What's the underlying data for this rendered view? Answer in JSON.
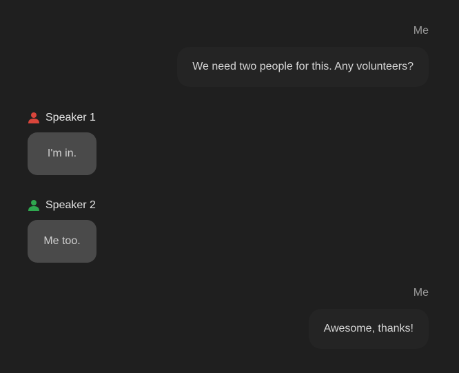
{
  "messages": [
    {
      "sender": "Me",
      "text": "We need two people for this. Any volunteers?"
    },
    {
      "sender": "Speaker 1",
      "text": "I'm in.",
      "icon": "person-icon",
      "icon_color": "#d9453b"
    },
    {
      "sender": "Speaker 2",
      "text": "Me too.",
      "icon": "person-icon",
      "icon_color": "#2fa84f"
    },
    {
      "sender": "Me",
      "text": "Awesome, thanks!"
    }
  ]
}
